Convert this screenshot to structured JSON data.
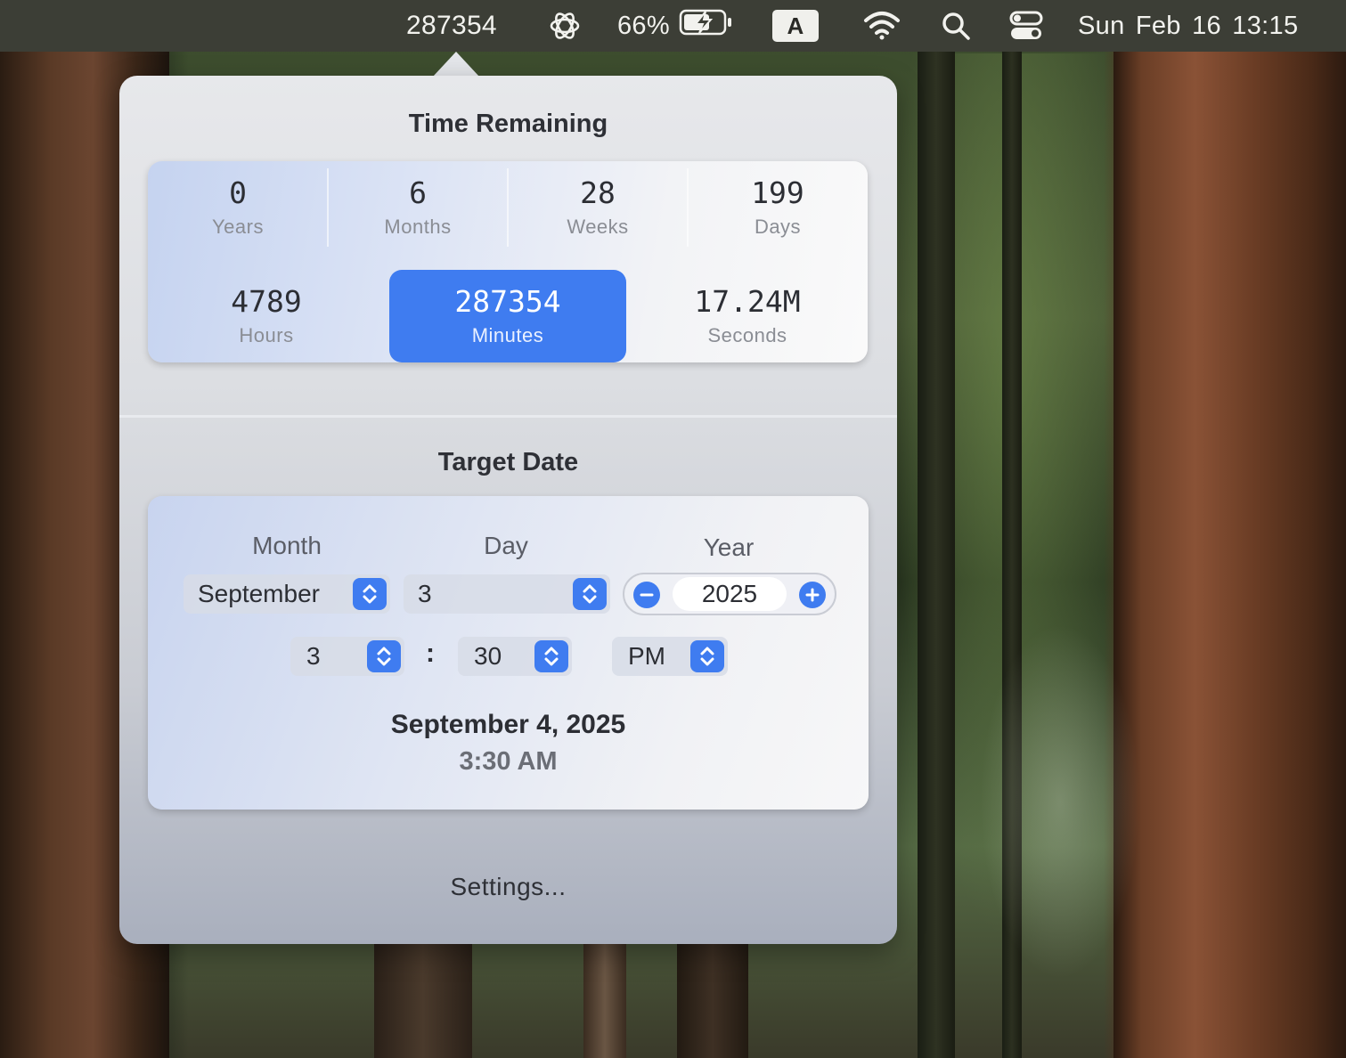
{
  "menubar": {
    "counter": "287354",
    "battery_percent": "66%",
    "input_source": "A",
    "clock": "Sun Feb 16  13:15",
    "icons": [
      "openai-icon",
      "battery-charging-icon",
      "wifi-icon",
      "search-icon",
      "control-center-icon"
    ]
  },
  "remaining": {
    "title": "Time Remaining",
    "years": {
      "value": "0",
      "label": "Years"
    },
    "months": {
      "value": "6",
      "label": "Months"
    },
    "weeks": {
      "value": "28",
      "label": "Weeks"
    },
    "days": {
      "value": "199",
      "label": "Days"
    },
    "hours": {
      "value": "4789",
      "label": "Hours"
    },
    "minutes": {
      "value": "287354",
      "label": "Minutes"
    },
    "seconds": {
      "value": "17.24M",
      "label": "Seconds"
    },
    "selected": "minutes"
  },
  "target": {
    "title": "Target Date",
    "month_label": "Month",
    "day_label": "Day",
    "year_label": "Year",
    "month": "September",
    "day": "3",
    "year": "2025",
    "hour": "3",
    "colon": ":",
    "minute": "30",
    "ampm": "PM",
    "summary_date": "September 4, 2025",
    "summary_time": "3:30 AM"
  },
  "settings_label": "Settings...",
  "colors": {
    "accent": "#3f7cf0",
    "menubar": "#3c3e36"
  }
}
